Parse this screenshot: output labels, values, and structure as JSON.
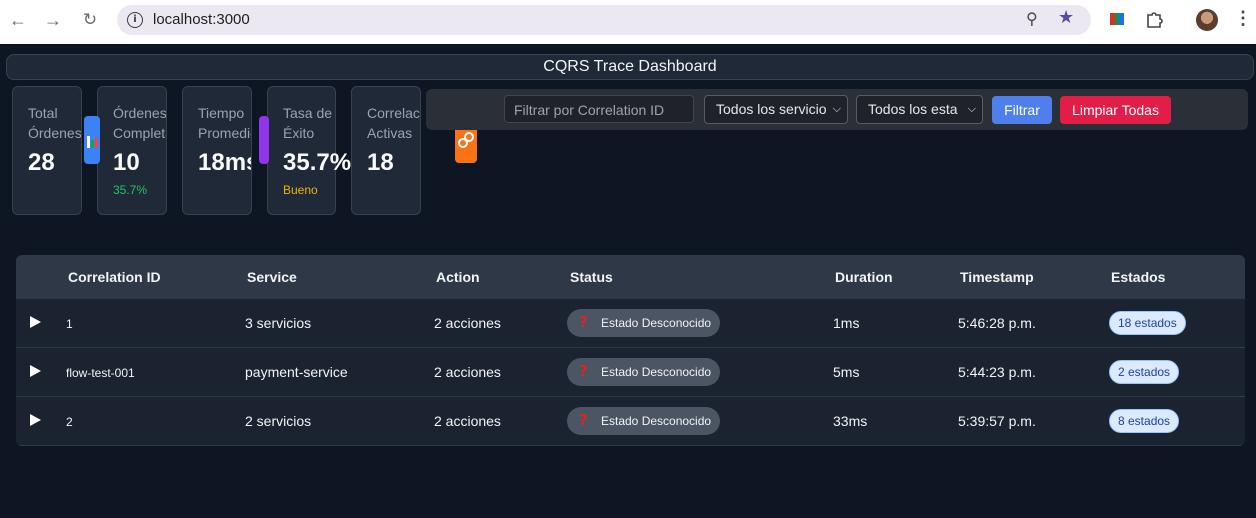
{
  "browser": {
    "url": "localhost:3000"
  },
  "header": {
    "title": "CQRS Trace Dashboard"
  },
  "stats": [
    {
      "label_line1": "Total",
      "label_line2": "Órdenes",
      "value": "28",
      "sub": ""
    },
    {
      "label_line1": "Órdenes",
      "label_line2": "Completad",
      "value": "10",
      "sub": "35.7%"
    },
    {
      "label_line1": "Tiempo",
      "label_line2": "Promedio",
      "value": "18ms",
      "sub": ""
    },
    {
      "label_line1": "Tasa de",
      "label_line2": "Éxito",
      "value": "35.7%",
      "sub": "Bueno"
    },
    {
      "label_line1": "Correlacio",
      "label_line2": "Activas",
      "value": "18",
      "sub": ""
    }
  ],
  "colors": {
    "success": "#22c55e",
    "warning": "#eab308",
    "filter_button": "#3b82f6",
    "clear_button": "#e11d48"
  },
  "filters": {
    "correlation_placeholder": "Filtrar por Correlation ID",
    "service_select": "Todos los servicio",
    "status_select": "Todos los esta",
    "filter_button": "Filtrar",
    "clear_button": "Limpiar Todas"
  },
  "table": {
    "headers": [
      "Correlation ID",
      "Service",
      "Action",
      "Status",
      "Duration",
      "Timestamp",
      "Estados"
    ],
    "rows": [
      {
        "correlation_id": "1",
        "service": "3 servicios",
        "action": "2 acciones",
        "status": "Estado Desconocido",
        "duration": "1ms",
        "timestamp": "5:46:28 p.m.",
        "estados": "18 estados"
      },
      {
        "correlation_id": "flow-test-001",
        "service": "payment-service",
        "action": "2 acciones",
        "status": "Estado Desconocido",
        "duration": "5ms",
        "timestamp": "5:44:23 p.m.",
        "estados": "2 estados"
      },
      {
        "correlation_id": "2",
        "service": "2 servicios",
        "action": "2 acciones",
        "status": "Estado Desconocido",
        "duration": "33ms",
        "timestamp": "5:39:57 p.m.",
        "estados": "8 estados"
      }
    ]
  }
}
